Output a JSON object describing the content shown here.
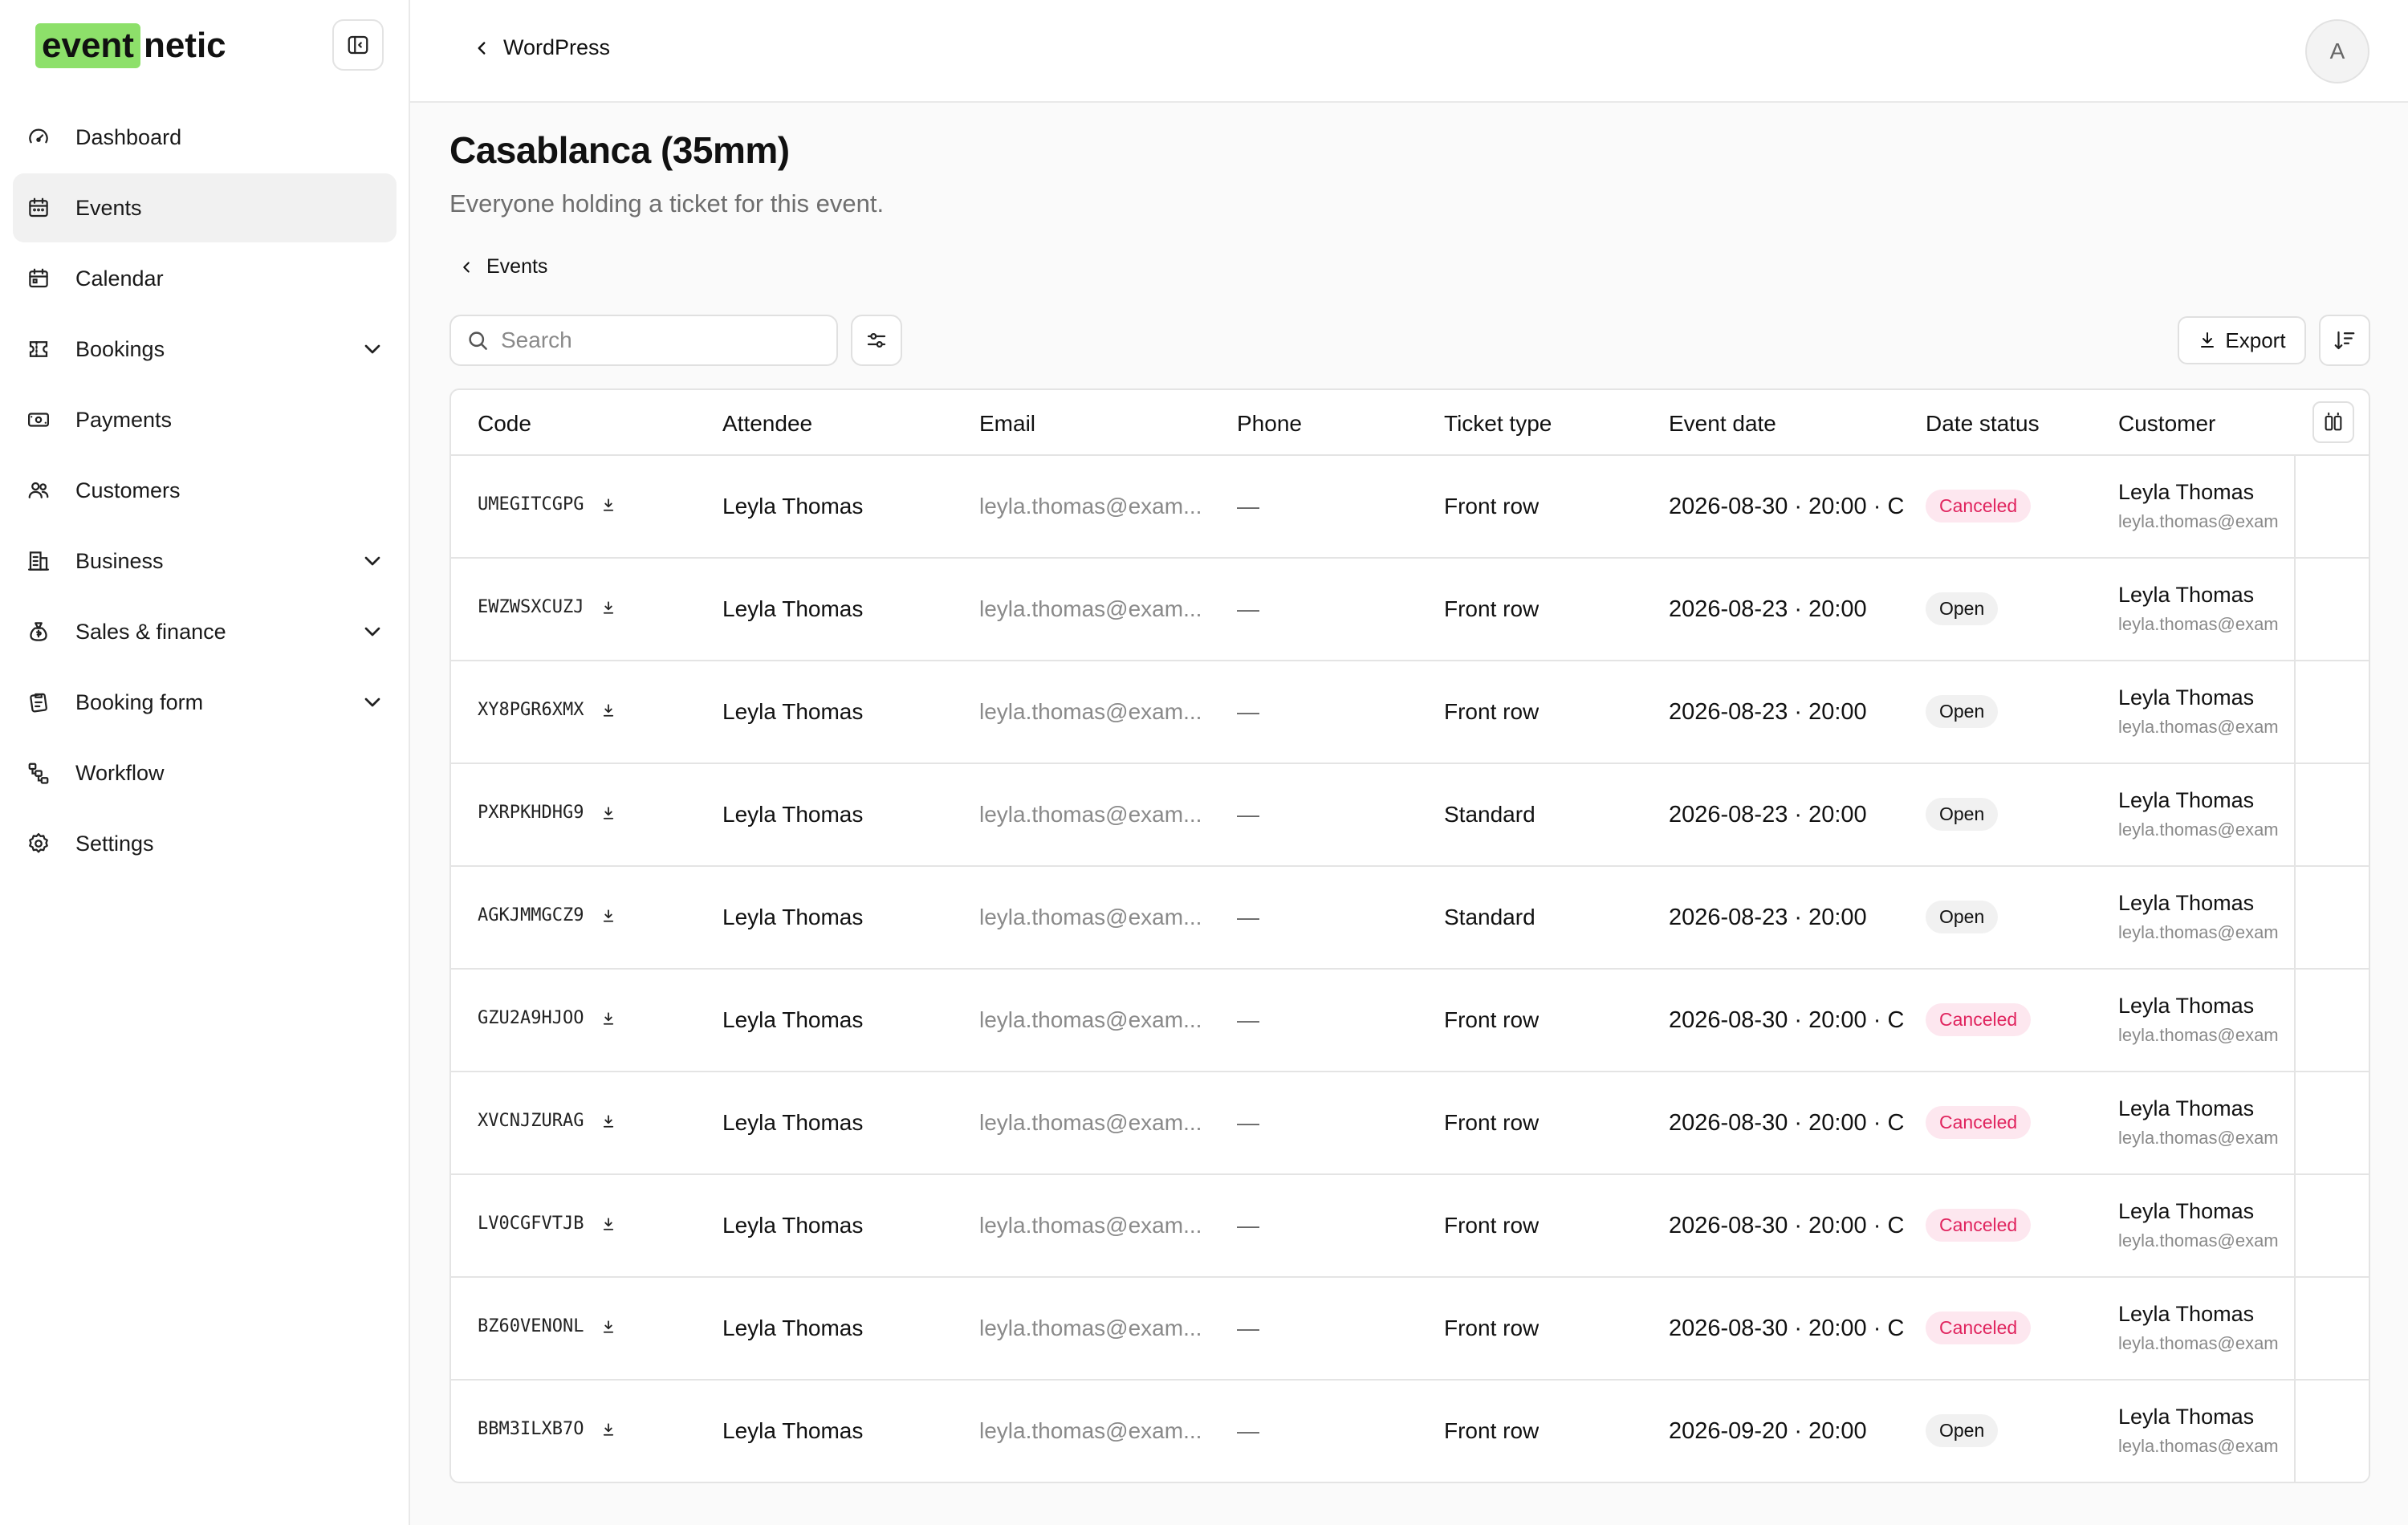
{
  "brand": {
    "logo_highlight": "event",
    "logo_rest": "netic"
  },
  "sidebar": {
    "items": [
      {
        "label": "Dashboard",
        "icon": "gauge-icon",
        "active": false,
        "expandable": false
      },
      {
        "label": "Events",
        "icon": "calendar-icon",
        "active": true,
        "expandable": false
      },
      {
        "label": "Calendar",
        "icon": "calendar-days-icon",
        "active": false,
        "expandable": false
      },
      {
        "label": "Bookings",
        "icon": "ticket-icon",
        "active": false,
        "expandable": true
      },
      {
        "label": "Payments",
        "icon": "banknote-icon",
        "active": false,
        "expandable": false
      },
      {
        "label": "Customers",
        "icon": "users-icon",
        "active": false,
        "expandable": false
      },
      {
        "label": "Business",
        "icon": "building-icon",
        "active": false,
        "expandable": true
      },
      {
        "label": "Sales & finance",
        "icon": "money-bag-icon",
        "active": false,
        "expandable": true
      },
      {
        "label": "Booking form",
        "icon": "clipboard-icon",
        "active": false,
        "expandable": true
      },
      {
        "label": "Workflow",
        "icon": "workflow-icon",
        "active": false,
        "expandable": false
      },
      {
        "label": "Settings",
        "icon": "gear-icon",
        "active": false,
        "expandable": false
      }
    ]
  },
  "header": {
    "back_label": "WordPress",
    "avatar_initial": "A"
  },
  "main": {
    "title": "Casablanca (35mm)",
    "subtitle": "Everyone holding a ticket for this event.",
    "breadcrumb": "Events",
    "search_placeholder": "Search",
    "export_label": "Export"
  },
  "table": {
    "columns": [
      "Code",
      "Attendee",
      "Email",
      "Phone",
      "Ticket type",
      "Event date",
      "Date status",
      "Customer"
    ],
    "rows": [
      {
        "code": "UMEGITCGPG",
        "attendee": "Leyla Thomas",
        "email": "leyla.thomas@exam...",
        "phone": "—",
        "ticket": "Front row",
        "date": "2026-08-30 · 20:00 · C",
        "status": "Canceled",
        "status_kind": "canceled",
        "customer_name": "Leyla Thomas",
        "customer_email": "leyla.thomas@exam"
      },
      {
        "code": "EWZWSXCUZJ",
        "attendee": "Leyla Thomas",
        "email": "leyla.thomas@exam...",
        "phone": "—",
        "ticket": "Front row",
        "date": "2026-08-23 · 20:00",
        "status": "Open",
        "status_kind": "open",
        "customer_name": "Leyla Thomas",
        "customer_email": "leyla.thomas@exam"
      },
      {
        "code": "XY8PGR6XMX",
        "attendee": "Leyla Thomas",
        "email": "leyla.thomas@exam...",
        "phone": "—",
        "ticket": "Front row",
        "date": "2026-08-23 · 20:00",
        "status": "Open",
        "status_kind": "open",
        "customer_name": "Leyla Thomas",
        "customer_email": "leyla.thomas@exam"
      },
      {
        "code": "PXRPKHDHG9",
        "attendee": "Leyla Thomas",
        "email": "leyla.thomas@exam...",
        "phone": "—",
        "ticket": "Standard",
        "date": "2026-08-23 · 20:00",
        "status": "Open",
        "status_kind": "open",
        "customer_name": "Leyla Thomas",
        "customer_email": "leyla.thomas@exam"
      },
      {
        "code": "AGKJMMGCZ9",
        "attendee": "Leyla Thomas",
        "email": "leyla.thomas@exam...",
        "phone": "—",
        "ticket": "Standard",
        "date": "2026-08-23 · 20:00",
        "status": "Open",
        "status_kind": "open",
        "customer_name": "Leyla Thomas",
        "customer_email": "leyla.thomas@exam"
      },
      {
        "code": "GZU2A9HJOO",
        "attendee": "Leyla Thomas",
        "email": "leyla.thomas@exam...",
        "phone": "—",
        "ticket": "Front row",
        "date": "2026-08-30 · 20:00 · C",
        "status": "Canceled",
        "status_kind": "canceled",
        "customer_name": "Leyla Thomas",
        "customer_email": "leyla.thomas@exam"
      },
      {
        "code": "XVCNJZURAG",
        "attendee": "Leyla Thomas",
        "email": "leyla.thomas@exam...",
        "phone": "—",
        "ticket": "Front row",
        "date": "2026-08-30 · 20:00 · C",
        "status": "Canceled",
        "status_kind": "canceled",
        "customer_name": "Leyla Thomas",
        "customer_email": "leyla.thomas@exam"
      },
      {
        "code": "LV0CGFVTJB",
        "attendee": "Leyla Thomas",
        "email": "leyla.thomas@exam...",
        "phone": "—",
        "ticket": "Front row",
        "date": "2026-08-30 · 20:00 · C",
        "status": "Canceled",
        "status_kind": "canceled",
        "customer_name": "Leyla Thomas",
        "customer_email": "leyla.thomas@exam"
      },
      {
        "code": "BZ60VENONL",
        "attendee": "Leyla Thomas",
        "email": "leyla.thomas@exam...",
        "phone": "—",
        "ticket": "Front row",
        "date": "2026-08-30 · 20:00 · C",
        "status": "Canceled",
        "status_kind": "canceled",
        "customer_name": "Leyla Thomas",
        "customer_email": "leyla.thomas@exam"
      },
      {
        "code": "BBM3ILXB7O",
        "attendee": "Leyla Thomas",
        "email": "leyla.thomas@exam...",
        "phone": "—",
        "ticket": "Front row",
        "date": "2026-09-20 · 20:00",
        "status": "Open",
        "status_kind": "open",
        "customer_name": "Leyla Thomas",
        "customer_email": "leyla.thomas@exam"
      }
    ]
  },
  "colors": {
    "brand_green": "#8de06a",
    "canceled_text": "#e0245e",
    "canceled_bg": "#fde7ef",
    "open_bg": "#f1f1f1"
  }
}
